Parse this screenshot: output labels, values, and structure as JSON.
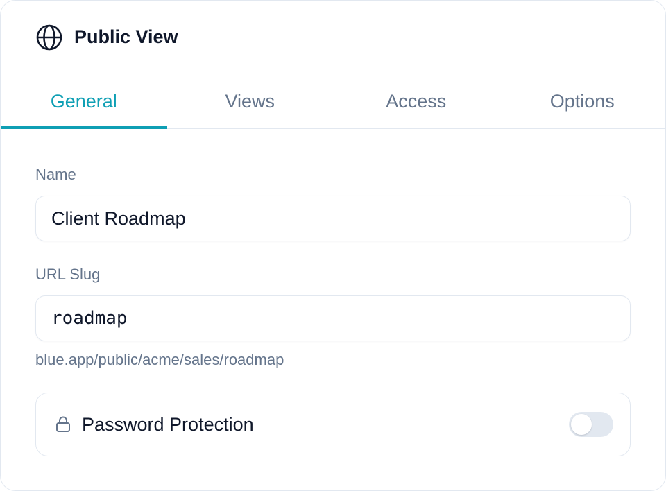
{
  "header": {
    "icon": "globe-icon",
    "title": "Public View"
  },
  "tabs": [
    {
      "label": "General",
      "active": true
    },
    {
      "label": "Views",
      "active": false
    },
    {
      "label": "Access",
      "active": false
    },
    {
      "label": "Options",
      "active": false
    }
  ],
  "form": {
    "name": {
      "label": "Name",
      "value": "Client Roadmap"
    },
    "slug": {
      "label": "URL Slug",
      "value": "roadmap",
      "hint": "blue.app/public/acme/sales/roadmap"
    },
    "password": {
      "icon": "lock-icon",
      "label": "Password Protection",
      "enabled": false
    }
  },
  "colors": {
    "accent": "#0e9fb4",
    "text": "#0f172a",
    "muted": "#64748b",
    "border": "#e2e8f0"
  }
}
